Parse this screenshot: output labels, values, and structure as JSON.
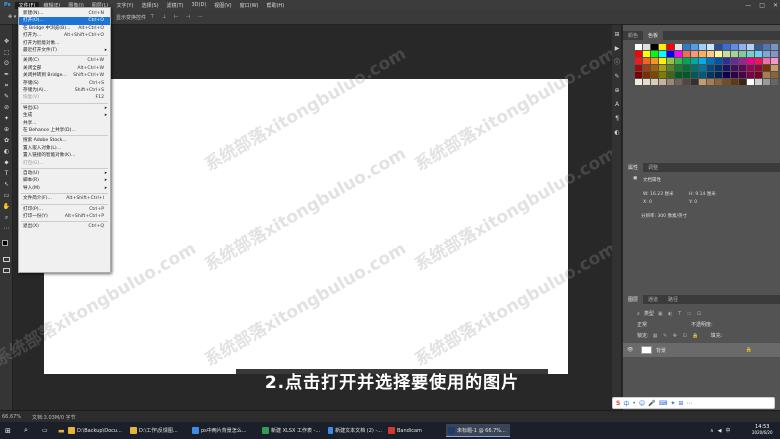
{
  "menubar": {
    "logo": "Ps",
    "items": [
      "文件(F)",
      "编辑(E)",
      "图像(I)",
      "图层(L)",
      "文字(Y)",
      "选择(S)",
      "滤镜(T)",
      "3D(D)",
      "视图(V)",
      "窗口(W)",
      "帮助(H)"
    ],
    "window_controls": [
      "—",
      "□",
      "✕"
    ]
  },
  "optbar": {
    "mode_label": "显示变换控件"
  },
  "toolbar": {
    "tools": [
      "✥",
      "⬚",
      "ʘ",
      "✒",
      "⌗",
      "✎",
      "⊘",
      "✦",
      "⊕",
      "✿",
      "◐",
      "⬥",
      "T",
      "↖",
      "▭",
      "✋",
      "⌕",
      "⋯"
    ]
  },
  "file_menu": {
    "items": [
      {
        "label": "新建(N)...",
        "shortcut": "Ctrl+N"
      },
      {
        "label": "打开(O)...",
        "shortcut": "Ctrl+O",
        "highlighted": true
      },
      {
        "label": "在 Bridge 中浏览(B)...",
        "shortcut": "Alt+Ctrl+O"
      },
      {
        "label": "打开为...",
        "shortcut": "Alt+Shift+Ctrl+O"
      },
      {
        "label": "打开为智能对象...",
        "shortcut": ""
      },
      {
        "label": "最近打开文件(T)",
        "shortcut": "",
        "submenu": true
      },
      {
        "sep": true
      },
      {
        "label": "关闭(C)",
        "shortcut": "Ctrl+W"
      },
      {
        "label": "关闭全部",
        "shortcut": "Alt+Ctrl+W"
      },
      {
        "label": "关闭并转到 Bridge...",
        "shortcut": "Shift+Ctrl+W"
      },
      {
        "label": "存储(S)",
        "shortcut": "Ctrl+S"
      },
      {
        "label": "存储为(A)...",
        "shortcut": "Shift+Ctrl+S"
      },
      {
        "label": "恢复(V)",
        "shortcut": "F12",
        "disabled": true
      },
      {
        "sep": true
      },
      {
        "label": "导出(E)",
        "shortcut": "",
        "submenu": true
      },
      {
        "label": "生成",
        "shortcut": "",
        "submenu": true
      },
      {
        "label": "共享...",
        "shortcut": ""
      },
      {
        "label": "在 Behance 上共享(D)...",
        "shortcut": ""
      },
      {
        "sep": true
      },
      {
        "label": "搜索 Adobe Stock...",
        "shortcut": ""
      },
      {
        "label": "置入嵌入对象(L)...",
        "shortcut": ""
      },
      {
        "label": "置入链接的智能对象(K)...",
        "shortcut": ""
      },
      {
        "label": "打包(G)...",
        "shortcut": "",
        "disabled": true
      },
      {
        "sep": true
      },
      {
        "label": "自动(U)",
        "shortcut": "",
        "submenu": true
      },
      {
        "label": "脚本(R)",
        "shortcut": "",
        "submenu": true
      },
      {
        "label": "导入(M)",
        "shortcut": "",
        "submenu": true
      },
      {
        "sep": true
      },
      {
        "label": "文件简介(F)...",
        "shortcut": "Alt+Shift+Ctrl+I"
      },
      {
        "sep": true
      },
      {
        "label": "打印(P)...",
        "shortcut": "Ctrl+P"
      },
      {
        "label": "打印一份(Y)",
        "shortcut": "Alt+Shift+Ctrl+P"
      },
      {
        "sep": true
      },
      {
        "label": "退出(X)",
        "shortcut": "Ctrl+Q"
      }
    ]
  },
  "swatches_panel": {
    "tabs": [
      "颜色",
      "色板"
    ],
    "active": 1
  },
  "properties_panel": {
    "tabs": [
      "属性",
      "调整"
    ],
    "title": "文档属性",
    "width_label": "W: 16.23 厘米",
    "height_label": "H: 9.14 厘米",
    "x_label": "X: 0",
    "y_label": "Y: 0",
    "resolution": "分辨率: 300 像素/英寸"
  },
  "layers_panel": {
    "tabs": [
      "图层",
      "通道",
      "路径"
    ],
    "kind_label": "类型",
    "mode_label": "正常",
    "opacity_label": "不透明度:",
    "lock_label": "锁定:",
    "fill_label": "填充:",
    "layer_name": "背景"
  },
  "statusbar": {
    "zoom": "66.67%",
    "doc_info": "文档:3.03M/0 字节"
  },
  "subtitle": "2.点击打开并选择要使用的图片",
  "watermark": "系统部落xitongbuluo.com",
  "taskbar": {
    "items": [
      {
        "label": "D:\\Backup\\Docu...",
        "color": "#e8b33b"
      },
      {
        "label": "D:\\工作\\反馈图...",
        "color": "#e8b33b"
      },
      {
        "label": "ps中两片背景怎么...",
        "color": "#3d8de8"
      },
      {
        "label": "新建 XLSX 工作表 -...",
        "color": "#2e9e54"
      },
      {
        "label": "新建文本文档 (2) -...",
        "color": "#3d8de8"
      },
      {
        "label": "Bandicam",
        "color": "#d03a2e"
      },
      {
        "label": "未标题-1 @ 66.7%...",
        "color": "#1d3c6e",
        "active": true
      }
    ],
    "time": "14:53",
    "date": "2020/6/20",
    "tray": [
      "中",
      "∧",
      "◀",
      "⊡"
    ]
  },
  "ime_toolbar": {
    "logo": "S",
    "items": [
      "中",
      "•",
      "☺",
      "🎤",
      "⌨",
      "✦",
      "⊞",
      "⋯"
    ]
  }
}
